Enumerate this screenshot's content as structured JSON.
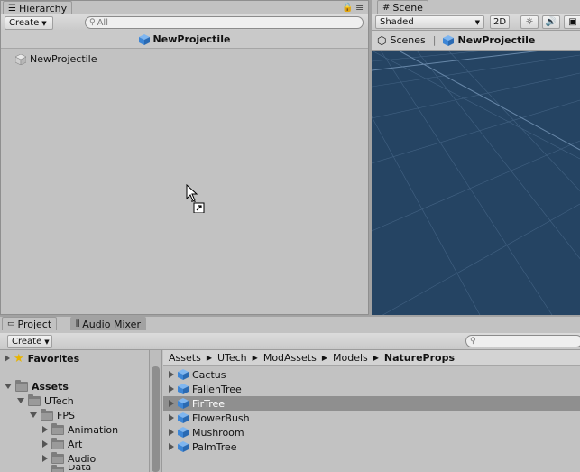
{
  "hierarchy": {
    "tab_label": "Hierarchy",
    "create_label": "Create",
    "search_placeholder": "All",
    "scene_title": "NewProjectile",
    "root_item": "NewProjectile"
  },
  "scene": {
    "tab_label": "Scene",
    "shading_mode": "Shaded",
    "mode_2d": "2D",
    "breadcrumb_scenes": "Scenes",
    "breadcrumb_prefab": "NewProjectile"
  },
  "project": {
    "tab_label": "Project",
    "audio_mixer_tab": "Audio Mixer",
    "create_label": "Create",
    "favorites_label": "Favorites",
    "tree": [
      {
        "label": "Assets",
        "bold": true,
        "level": 0
      },
      {
        "label": "UTech",
        "bold": false,
        "level": 1
      },
      {
        "label": "FPS",
        "bold": false,
        "level": 2
      },
      {
        "label": "Animation",
        "bold": false,
        "level": 3
      },
      {
        "label": "Art",
        "bold": false,
        "level": 3
      },
      {
        "label": "Audio",
        "bold": false,
        "level": 3
      },
      {
        "label": "Data",
        "bold": false,
        "level": 3
      }
    ],
    "breadcrumb": [
      "Assets",
      "UTech",
      "ModAssets",
      "Models",
      "NatureProps"
    ],
    "assets": [
      "Cactus",
      "FallenTree",
      "FirTree",
      "FlowerBush",
      "Mushroom",
      "PalmTree"
    ],
    "selected_asset": "FirTree"
  },
  "colors": {
    "scene_bg": "#254463",
    "selected_row": "#8f8f8f",
    "prefab_cube": "#3d86d6"
  }
}
